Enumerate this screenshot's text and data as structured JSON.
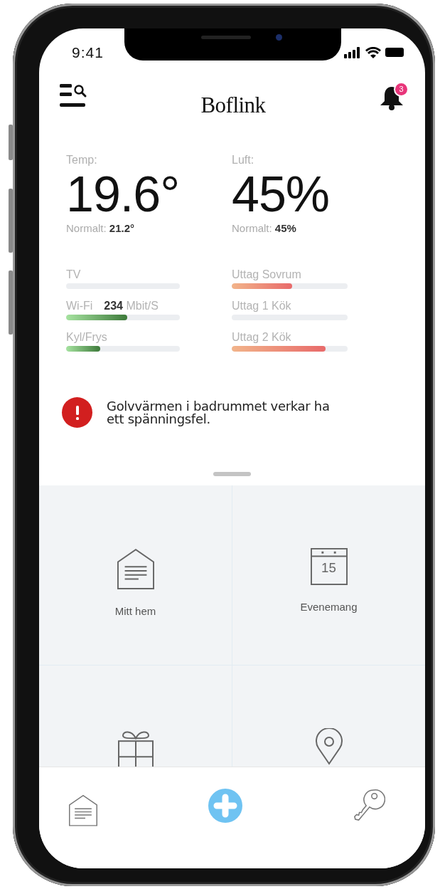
{
  "status_bar": {
    "time": "9:41"
  },
  "header": {
    "title": "Boflink",
    "notification_count": "3"
  },
  "stats": [
    {
      "label": "Temp:",
      "value": "19.6°",
      "normal": "Normalt: **21.2°**"
    },
    {
      "label": "Luft:",
      "value": "45%",
      "normal": "Normalt: **45%**"
    }
  ],
  "meters": [
    {
      "label": "TV",
      "level": 0,
      "kind": "device"
    },
    {
      "label": "Uttag Sovrum",
      "level": 0.52,
      "kind": "outlet"
    },
    {
      "label": "Wi-Fi",
      "reading": "**234** Mbit/S",
      "level": 0.54,
      "kind": "device"
    },
    {
      "label": "Uttag 1 Kök",
      "level": 0,
      "kind": "outlet"
    },
    {
      "label": "Kyl/Frys",
      "level": 0.3,
      "kind": "device"
    },
    {
      "label": "Uttag 2 Kök",
      "level": 0.81,
      "kind": "outlet"
    }
  ],
  "alert": {
    "message": "Golvvärmen i badrummet verkar ha ett spänningsfel."
  },
  "tiles": [
    {
      "kind": "home",
      "label": "Mitt hem"
    },
    {
      "kind": "calendar",
      "label": "Evenemang",
      "day": "15"
    },
    {
      "kind": "gift"
    },
    {
      "kind": "pin"
    }
  ],
  "bottom_nav": [
    {
      "kind": "home"
    },
    {
      "kind": "add"
    },
    {
      "kind": "key"
    }
  ]
}
